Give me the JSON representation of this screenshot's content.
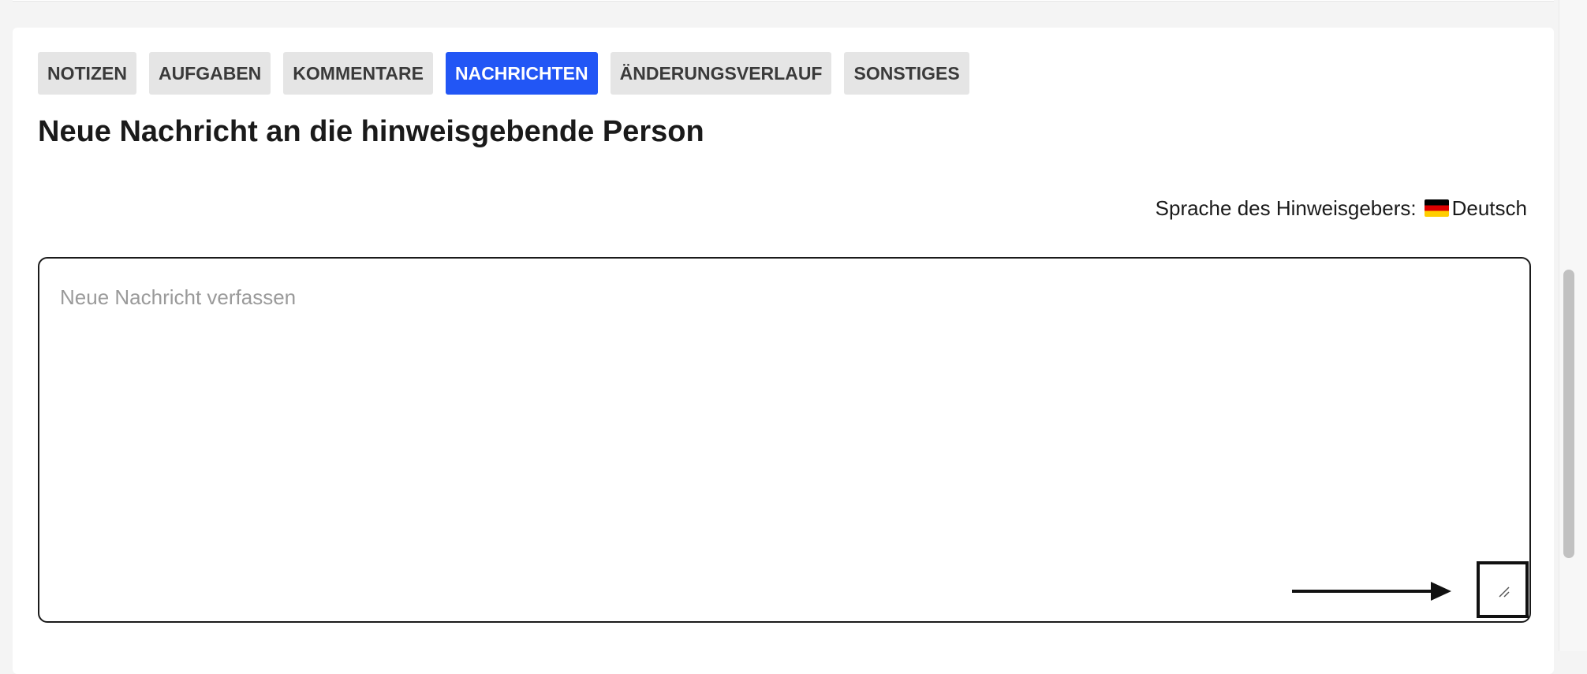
{
  "tabs": [
    {
      "label": "NOTIZEN",
      "active": false
    },
    {
      "label": "AUFGABEN",
      "active": false
    },
    {
      "label": "KOMMENTARE",
      "active": false
    },
    {
      "label": "NACHRICHTEN",
      "active": true
    },
    {
      "label": "ÄNDERUNGSVERLAUF",
      "active": false
    },
    {
      "label": "SONSTIGES",
      "active": false
    }
  ],
  "page": {
    "title": "Neue Nachricht an die hinweisgebende Person"
  },
  "language": {
    "label": "Sprache des Hinweisgebers:",
    "flag_icon": "germany-flag-icon",
    "value": "Deutsch"
  },
  "compose": {
    "placeholder": "Neue Nachricht verfassen",
    "value": ""
  },
  "colors": {
    "accent": "#2256f5",
    "tab_bg": "#e5e5e5"
  }
}
